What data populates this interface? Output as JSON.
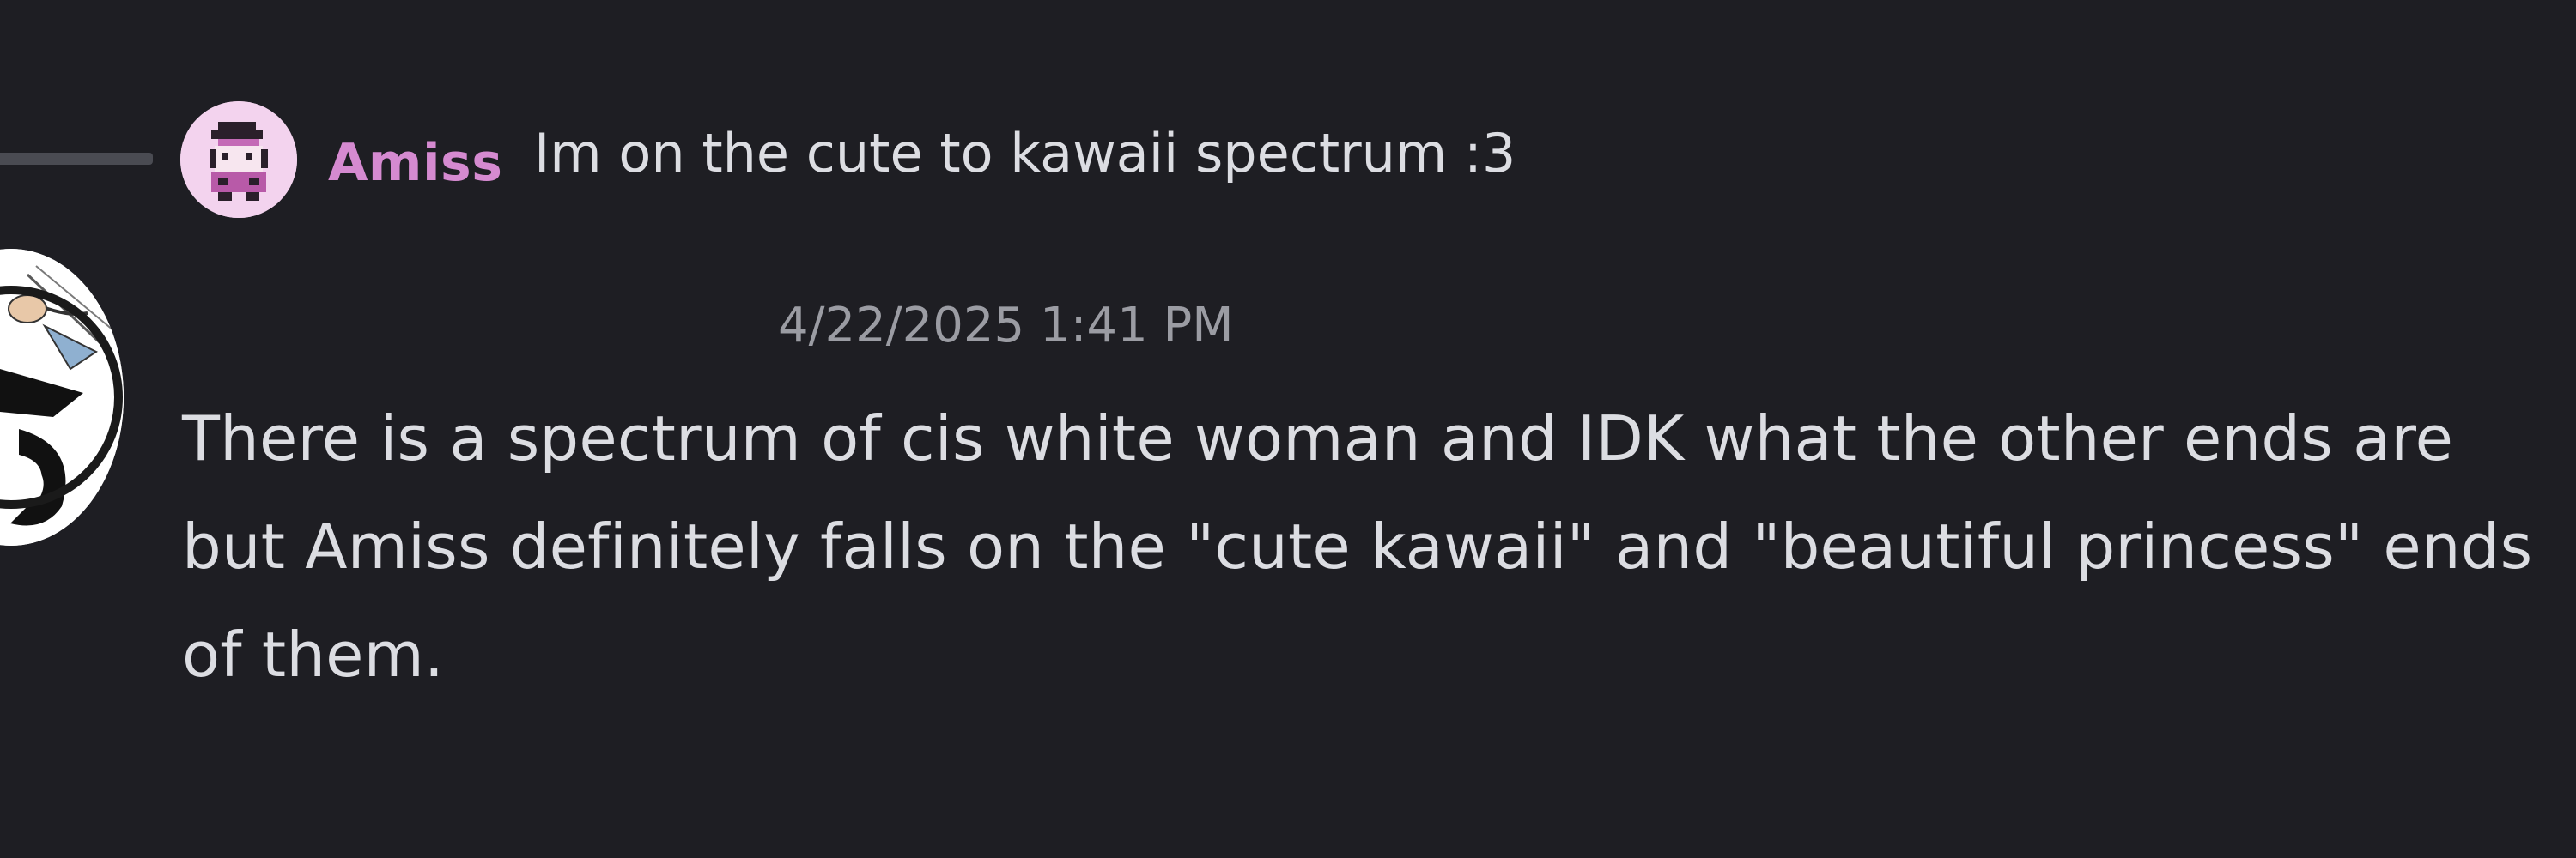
{
  "reply": {
    "author": "Amiss",
    "author_color": "#d58ad0",
    "preview_text": "Im on the cute to kawaii spectrum :3",
    "avatar_icon": "pixel-character-avatar"
  },
  "message": {
    "avatar_icon": "drawn-character-avatar",
    "timestamp": "4/22/2025 1:41 PM",
    "body": "There is a spectrum of cis white woman and IDK what the other ends are but Amiss definitely falls on the \"cute kawaii\" and \"beautiful princess\" ends of them."
  },
  "colors": {
    "background": "#1e1e23",
    "text": "#dcdde2",
    "muted": "#9b9ca3"
  }
}
